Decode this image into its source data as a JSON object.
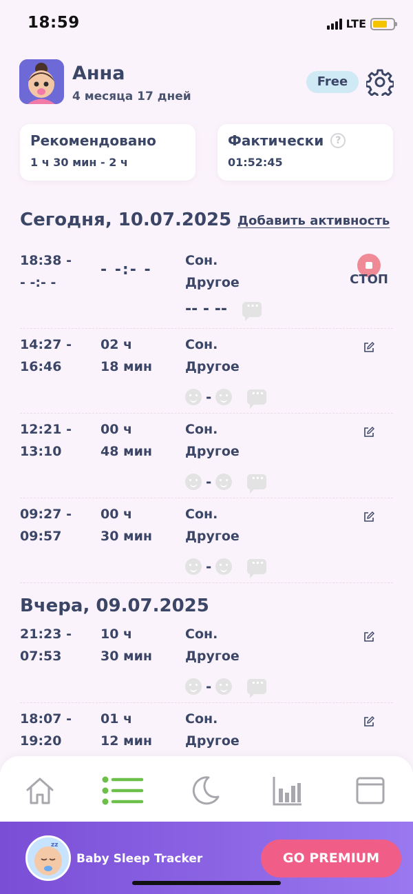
{
  "status_bar": {
    "time": "18:59",
    "network": "LTE"
  },
  "header": {
    "name": "Анна",
    "age": "4 месяца 17 дней",
    "plan_badge": "Free"
  },
  "cards": {
    "recommended": {
      "title": "Рекомендовано",
      "value": "1 ч 30 мин - 2 ч"
    },
    "actual": {
      "title": "Фактически",
      "value": "01:52:45",
      "help": "?"
    }
  },
  "today": {
    "heading": "Сегодня, 10.07.2025",
    "add_activity": "Добавить активность",
    "active": {
      "start": "18:38 -",
      "end": "- -:- -",
      "duration": "- -:- -",
      "type1": "Сон.",
      "type2": "Другое",
      "mood": "-- - --",
      "stop_label": "СТОП"
    },
    "entries": [
      {
        "start": "14:27 -",
        "end": "16:46",
        "hours": "02 ч",
        "minutes": "18 мин",
        "type1": "Сон.",
        "type2": "Другое"
      },
      {
        "start": "12:21 -",
        "end": "13:10",
        "hours": "00 ч",
        "minutes": "48 мин",
        "type1": "Сон.",
        "type2": "Другое"
      },
      {
        "start": "09:27 -",
        "end": "09:57",
        "hours": "00 ч",
        "minutes": "30 мин",
        "type1": "Сон.",
        "type2": "Другое"
      }
    ]
  },
  "yesterday": {
    "heading": "Вчера, 09.07.2025",
    "entries": [
      {
        "start": "21:23 -",
        "end": "07:53",
        "hours": "10 ч",
        "minutes": "30 мин",
        "type1": "Сон.",
        "type2": "Другое"
      },
      {
        "start": "18:07 -",
        "end": "19:20",
        "hours": "01 ч",
        "minutes": "12 мин",
        "type1": "Сон.",
        "type2": "Другое"
      }
    ]
  },
  "tabs": [
    "home-icon",
    "list-icon",
    "moon-icon",
    "chart-icon",
    "calendar-icon"
  ],
  "premium": {
    "app_name": "Baby Sleep Tracker",
    "button": "GO PREMIUM"
  },
  "colors": {
    "accent_green": "#6cc04a",
    "stop_red": "#f08a97",
    "premium_pink": "#f05d86"
  }
}
